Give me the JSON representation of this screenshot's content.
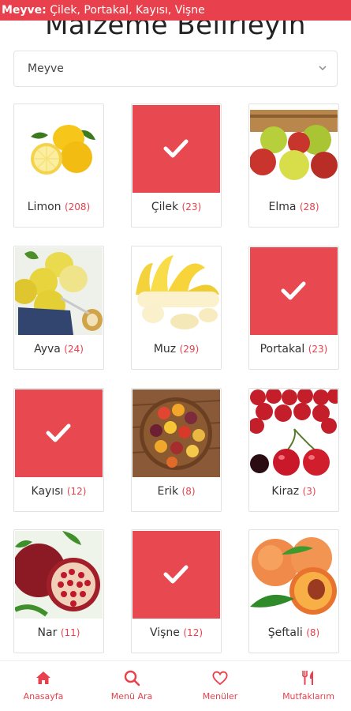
{
  "banner": {
    "category": "Meyve:",
    "items": "Çilek, Portakal, Kayısı, Vişne"
  },
  "page": {
    "title": "Malzeme Belirleyin"
  },
  "select": {
    "value": "Meyve",
    "icon": "chevron-down-icon"
  },
  "accent_color": "#e8404c",
  "items": [
    {
      "name": "Limon",
      "count": "(208)",
      "selected": false
    },
    {
      "name": "Çilek",
      "count": "(23)",
      "selected": true
    },
    {
      "name": "Elma",
      "count": "(28)",
      "selected": false
    },
    {
      "name": "Ayva",
      "count": "(24)",
      "selected": false
    },
    {
      "name": "Muz",
      "count": "(29)",
      "selected": false
    },
    {
      "name": "Portakal",
      "count": "(23)",
      "selected": true
    },
    {
      "name": "Kayısı",
      "count": "(12)",
      "selected": true
    },
    {
      "name": "Erik",
      "count": "(8)",
      "selected": false
    },
    {
      "name": "Kiraz",
      "count": "(3)",
      "selected": false
    },
    {
      "name": "Nar",
      "count": "(11)",
      "selected": false
    },
    {
      "name": "Vişne",
      "count": "(12)",
      "selected": true
    },
    {
      "name": "Şeftali",
      "count": "(8)",
      "selected": false
    }
  ],
  "tabs": [
    {
      "label": "Anasayfa",
      "icon": "home-icon"
    },
    {
      "label": "Menü Ara",
      "icon": "search-icon"
    },
    {
      "label": "Menüler",
      "icon": "heart-icon"
    },
    {
      "label": "Mutfaklarım",
      "icon": "utensils-icon"
    }
  ]
}
